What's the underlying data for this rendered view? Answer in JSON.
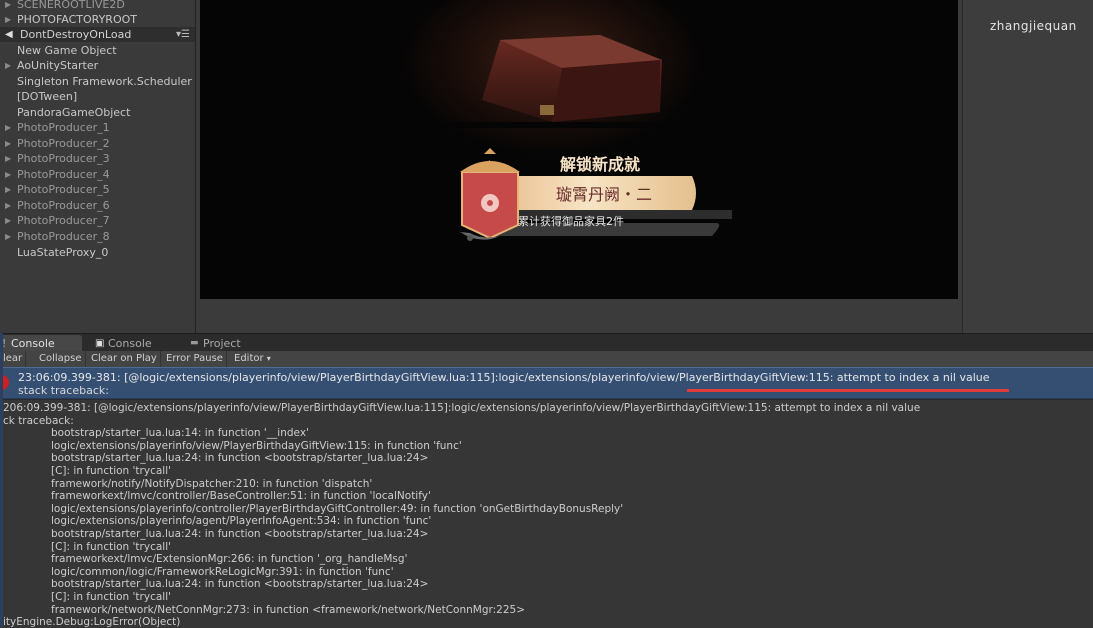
{
  "hierarchy": {
    "scene_name": "DontDestroyOnLoad",
    "items": [
      {
        "label": "SCENEROOTLIVE2D",
        "expandable": true
      },
      {
        "label": "PHOTOFACTORYROOT",
        "expandable": true
      },
      {
        "label": "New Game Object",
        "expandable": false
      },
      {
        "label": "AoUnityStarter",
        "expandable": true
      },
      {
        "label": "Singleton Framework.Scheduler",
        "expandable": false
      },
      {
        "label": "[DOTween]",
        "expandable": false
      },
      {
        "label": "PandoraGameObject",
        "expandable": false
      },
      {
        "label": "PhotoProducer_1",
        "expandable": true
      },
      {
        "label": "PhotoProducer_2",
        "expandable": true
      },
      {
        "label": "PhotoProducer_3",
        "expandable": true
      },
      {
        "label": "PhotoProducer_4",
        "expandable": true
      },
      {
        "label": "PhotoProducer_5",
        "expandable": true
      },
      {
        "label": "PhotoProducer_6",
        "expandable": true
      },
      {
        "label": "PhotoProducer_7",
        "expandable": true
      },
      {
        "label": "PhotoProducer_8",
        "expandable": true
      },
      {
        "label": "LuaStateProxy_0",
        "expandable": false
      }
    ]
  },
  "game_view": {
    "achievement_title": "解锁新成就",
    "achievement_name": "璇霄丹阙・二",
    "achievement_desc": "累计获得御品家具2件"
  },
  "inspector": {
    "username": "zhangjiequan"
  },
  "tabs": [
    {
      "label": "Console",
      "active": true
    },
    {
      "label": "Console",
      "active": false
    },
    {
      "label": "Project",
      "active": false
    }
  ],
  "toolbar": {
    "clear": "lear",
    "collapse": "Collapse",
    "clear_on_play": "Clear on Play",
    "error_pause": "Error Pause",
    "editor": "Editor"
  },
  "console": {
    "selected_line1": "23:06:09.399-381: [@logic/extensions/playerinfo/view/PlayerBirthdayGiftView.lua:115]:logic/extensions/playerinfo/view/PlayerBirthdayGiftView:115: attempt to index a nil value",
    "selected_line2": "stack traceback:",
    "detail": [
      {
        "text": "206:09.399-381: [@logic/extensions/playerinfo/view/PlayerBirthdayGiftView.lua:115]:logic/extensions/playerinfo/view/PlayerBirthdayGiftView:115: attempt to index a nil value",
        "indent": false
      },
      {
        "text": "ck traceback:",
        "indent": false
      },
      {
        "text": "bootstrap/starter_lua.lua:14: in function '__index'",
        "indent": true
      },
      {
        "text": "logic/extensions/playerinfo/view/PlayerBirthdayGiftView:115: in function 'func'",
        "indent": true
      },
      {
        "text": "bootstrap/starter_lua.lua:24: in function <bootstrap/starter_lua.lua:24>",
        "indent": true
      },
      {
        "text": "[C]: in function 'trycall'",
        "indent": true
      },
      {
        "text": "framework/notify/NotifyDispatcher:210: in function 'dispatch'",
        "indent": true
      },
      {
        "text": "frameworkext/lmvc/controller/BaseController:51: in function 'localNotify'",
        "indent": true
      },
      {
        "text": "logic/extensions/playerinfo/controller/PlayerBirthdayGiftController:49: in function 'onGetBirthdayBonusReply'",
        "indent": true
      },
      {
        "text": "logic/extensions/playerinfo/agent/PlayerInfoAgent:534: in function 'func'",
        "indent": true
      },
      {
        "text": "bootstrap/starter_lua.lua:24: in function <bootstrap/starter_lua.lua:24>",
        "indent": true
      },
      {
        "text": "[C]: in function 'trycall'",
        "indent": true
      },
      {
        "text": "frameworkext/lmvc/ExtensionMgr:266: in function '_org_handleMsg'",
        "indent": true
      },
      {
        "text": "logic/common/logic/FrameworkReLogicMgr:391: in function 'func'",
        "indent": true
      },
      {
        "text": "bootstrap/starter_lua.lua:24: in function <bootstrap/starter_lua.lua:24>",
        "indent": true
      },
      {
        "text": "[C]: in function 'trycall'",
        "indent": true
      },
      {
        "text": "framework/network/NetConnMgr:273: in function <framework/network/NetConnMgr:225>",
        "indent": true
      },
      {
        "text": "ityEngine.Debug:LogError(Object)",
        "indent": false
      }
    ]
  }
}
